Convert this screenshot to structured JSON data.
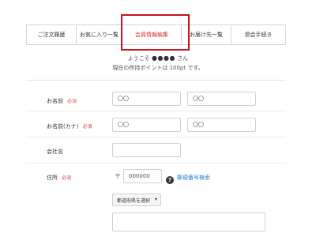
{
  "tabs": [
    {
      "label": "ご注文履歴",
      "active": false
    },
    {
      "label": "お気に入り一覧",
      "active": false
    },
    {
      "label": "会員情報編集",
      "active": true
    },
    {
      "label": "お届け先一覧",
      "active": false
    },
    {
      "label": "退会手続き",
      "active": false
    }
  ],
  "welcome": {
    "prefix": "ようこそ",
    "name_dots": "●●●●",
    "suffix": "さん",
    "points_line": "現在の所持ポイントは 100pt です。"
  },
  "form": {
    "required_mark": "必須",
    "name": {
      "label": "お名前",
      "last_value": "〇〇",
      "first_value": "〇〇"
    },
    "kana": {
      "label": "お名前(カナ)",
      "last_value": "〇〇",
      "first_value": "〇〇"
    },
    "company": {
      "label": "会社名",
      "value": ""
    },
    "address": {
      "label": "住所",
      "postal_mark": "〒",
      "postal_value": "000000",
      "help_icon": "?",
      "zip_search_link": "郵便番号検索",
      "prefecture_select": "都道府県を選択",
      "address_value": ""
    }
  },
  "colors": {
    "accent_red": "#c4111b",
    "link_blue": "#2a7fc7",
    "required_red": "#e0454b"
  }
}
